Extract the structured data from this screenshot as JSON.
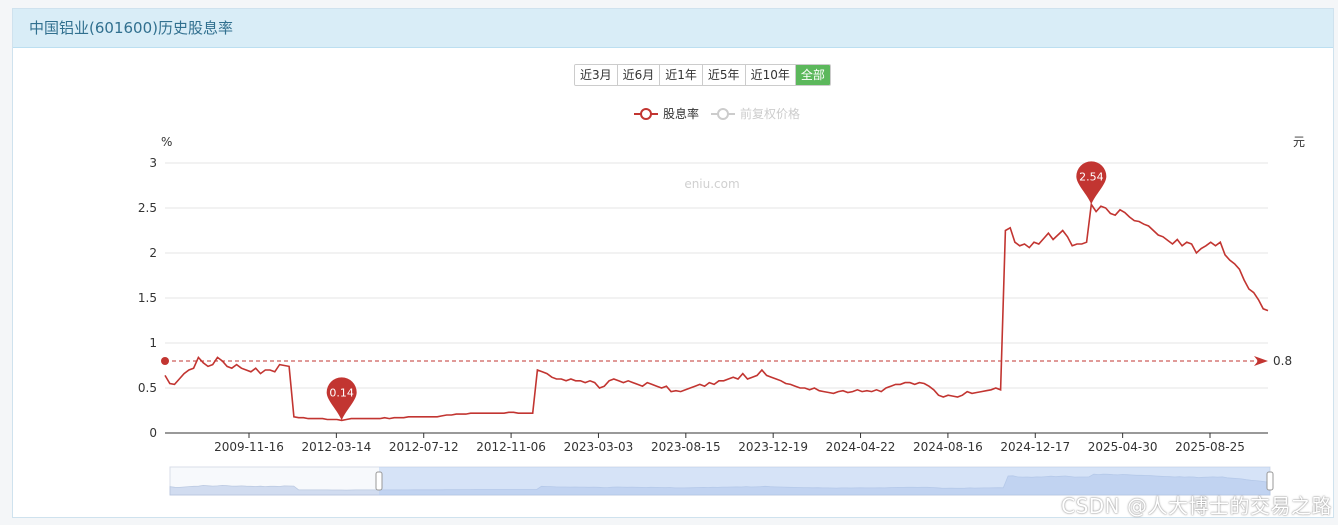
{
  "panel": {
    "title": "中国铝业(601600)历史股息率"
  },
  "range_buttons": [
    {
      "label": "近3月",
      "active": false
    },
    {
      "label": "近6月",
      "active": false
    },
    {
      "label": "近1年",
      "active": false
    },
    {
      "label": "近5年",
      "active": false
    },
    {
      "label": "近10年",
      "active": false
    },
    {
      "label": "全部",
      "active": true
    }
  ],
  "watermark": "CSDN @人大博士的交易之路",
  "chart_data": {
    "type": "line",
    "chart_watermark": "eniu.com",
    "y_left_unit": "%",
    "y_right_unit": "元",
    "ylim": [
      0,
      3
    ],
    "y_ticks": [
      0,
      0.5,
      1,
      1.5,
      2,
      2.5,
      3
    ],
    "x_tick_labels": [
      "2009-11-16",
      "2012-03-14",
      "2012-07-12",
      "2012-11-06",
      "2023-03-03",
      "2023-08-15",
      "2023-12-19",
      "2024-04-22",
      "2024-08-16",
      "2024-12-17",
      "2025-04-30",
      "2025-08-25"
    ],
    "grid": true,
    "legend_position": "top",
    "series": [
      {
        "name": "股息率",
        "color": "#c23531",
        "visible": true,
        "values": [
          0.64,
          0.55,
          0.54,
          0.6,
          0.66,
          0.7,
          0.72,
          0.84,
          0.78,
          0.74,
          0.76,
          0.84,
          0.8,
          0.74,
          0.72,
          0.76,
          0.72,
          0.7,
          0.68,
          0.72,
          0.66,
          0.7,
          0.7,
          0.68,
          0.76,
          0.75,
          0.74,
          0.18,
          0.17,
          0.17,
          0.16,
          0.16,
          0.16,
          0.16,
          0.15,
          0.15,
          0.15,
          0.14,
          0.15,
          0.16,
          0.16,
          0.16,
          0.16,
          0.16,
          0.16,
          0.16,
          0.17,
          0.16,
          0.17,
          0.17,
          0.17,
          0.18,
          0.18,
          0.18,
          0.18,
          0.18,
          0.18,
          0.18,
          0.19,
          0.2,
          0.2,
          0.21,
          0.21,
          0.21,
          0.22,
          0.22,
          0.22,
          0.22,
          0.22,
          0.22,
          0.22,
          0.22,
          0.23,
          0.23,
          0.22,
          0.22,
          0.22,
          0.22,
          0.7,
          0.68,
          0.66,
          0.62,
          0.6,
          0.6,
          0.58,
          0.6,
          0.58,
          0.58,
          0.56,
          0.58,
          0.56,
          0.5,
          0.52,
          0.58,
          0.6,
          0.58,
          0.56,
          0.58,
          0.56,
          0.54,
          0.52,
          0.56,
          0.54,
          0.52,
          0.5,
          0.52,
          0.46,
          0.47,
          0.46,
          0.48,
          0.5,
          0.52,
          0.54,
          0.52,
          0.56,
          0.54,
          0.58,
          0.58,
          0.6,
          0.62,
          0.6,
          0.66,
          0.6,
          0.62,
          0.64,
          0.7,
          0.64,
          0.62,
          0.6,
          0.58,
          0.55,
          0.54,
          0.52,
          0.5,
          0.5,
          0.48,
          0.5,
          0.47,
          0.46,
          0.45,
          0.44,
          0.46,
          0.47,
          0.45,
          0.46,
          0.48,
          0.46,
          0.47,
          0.46,
          0.48,
          0.46,
          0.5,
          0.52,
          0.54,
          0.54,
          0.56,
          0.56,
          0.54,
          0.56,
          0.55,
          0.52,
          0.48,
          0.42,
          0.4,
          0.42,
          0.41,
          0.4,
          0.42,
          0.46,
          0.44,
          0.45,
          0.46,
          0.47,
          0.48,
          0.5,
          0.48,
          2.25,
          2.28,
          2.12,
          2.08,
          2.1,
          2.06,
          2.12,
          2.1,
          2.16,
          2.22,
          2.15,
          2.2,
          2.25,
          2.18,
          2.08,
          2.1,
          2.1,
          2.12,
          2.54,
          2.46,
          2.52,
          2.5,
          2.44,
          2.42,
          2.48,
          2.45,
          2.4,
          2.36,
          2.35,
          2.32,
          2.3,
          2.25,
          2.2,
          2.18,
          2.14,
          2.1,
          2.15,
          2.08,
          2.12,
          2.1,
          2.0,
          2.05,
          2.08,
          2.12,
          2.08,
          2.12,
          1.98,
          1.92,
          1.88,
          1.82,
          1.7,
          1.6,
          1.56,
          1.48,
          1.38,
          1.36
        ]
      },
      {
        "name": "前复权价格",
        "color": "#cccccc",
        "visible": false,
        "values": []
      }
    ],
    "mark_points": [
      {
        "label": "2.54",
        "value": 2.54,
        "type": "max"
      },
      {
        "label": "0.14",
        "value": 0.14,
        "type": "min"
      }
    ],
    "mark_line": {
      "label": "0.8",
      "value": 0.8
    },
    "data_zoom": {
      "start_fraction": 0.19,
      "end_fraction": 1.0
    }
  }
}
